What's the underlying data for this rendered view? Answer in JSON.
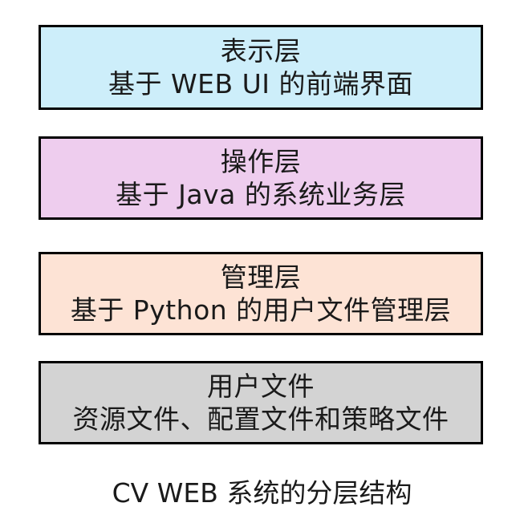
{
  "layers": [
    {
      "title": "表示层",
      "description": "基于 WEB UI 的前端界面",
      "fill_color": "#cdeefa"
    },
    {
      "title": "操作层",
      "description": "基于 Java 的系统业务层",
      "fill_color": "#eecdee"
    },
    {
      "title": "管理层",
      "description": "基于 Python 的用户文件管理层",
      "fill_color": "#fde3d5"
    },
    {
      "title": "用户文件",
      "description": "资源文件、配置文件和策略文件",
      "fill_color": "#d3d3d3"
    }
  ],
  "caption": "CV WEB 系统的分层结构"
}
